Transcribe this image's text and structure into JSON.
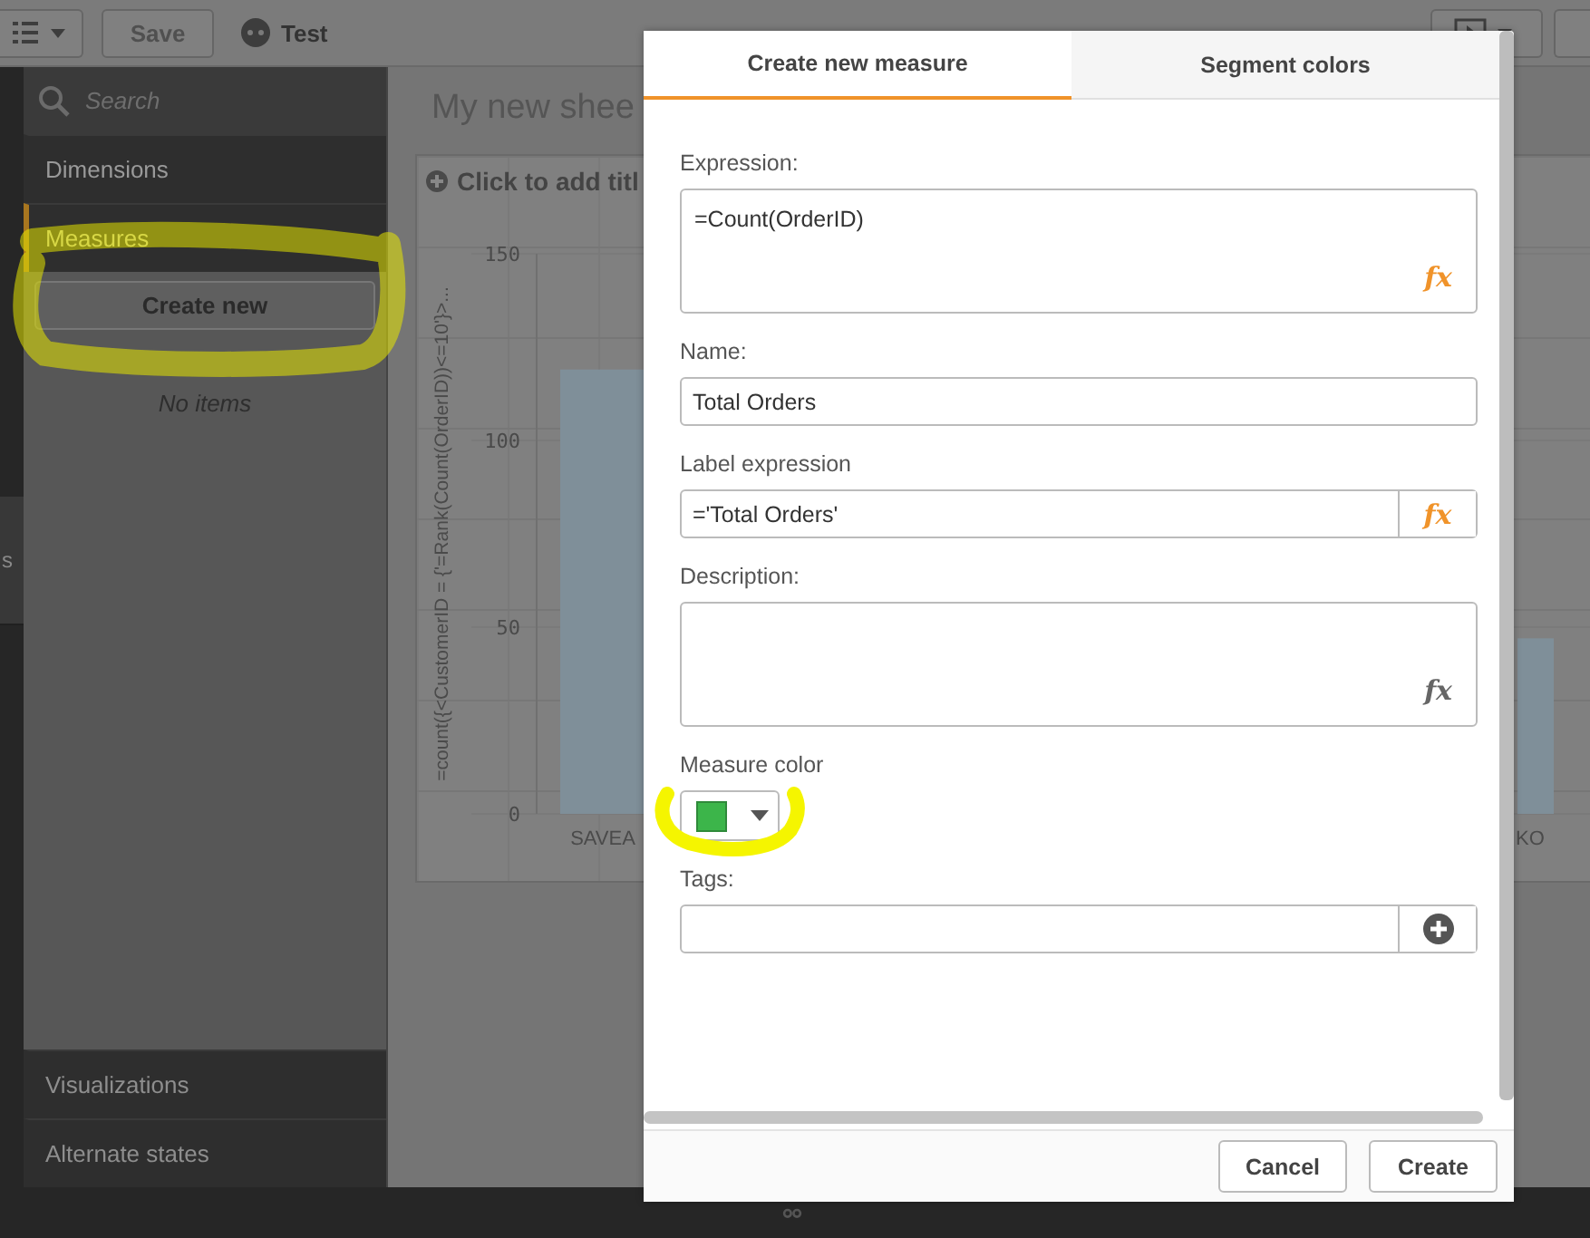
{
  "toolbar": {
    "save_button": "Save",
    "app_title": "Test"
  },
  "left_strip": {
    "items": [
      "s"
    ]
  },
  "assets_panel": {
    "search": {
      "placeholder": "Search"
    },
    "sections": [
      {
        "label": "Dimensions",
        "selected": false
      },
      {
        "label": "Measures",
        "selected": true
      }
    ],
    "create_button": "Create new",
    "empty_text": "No items",
    "bottom_sections": [
      {
        "label": "Visualizations"
      },
      {
        "label": "Alternate states"
      }
    ]
  },
  "sheet": {
    "title": "My new shee",
    "chart": {
      "add_title": "Click to add titl",
      "chart_data": {
        "type": "bar",
        "ylabel": "=count({<CustomerID = {'=Rank(Count(OrderID))<=10'}>...",
        "categories": [
          "SAVEA",
          "KO"
        ],
        "values": [
          119,
          47
        ],
        "ylim": [
          0,
          150
        ],
        "yticks": [
          0,
          50,
          100,
          150
        ]
      }
    }
  },
  "dialog": {
    "tabs": [
      {
        "label": "Create new measure",
        "selected": true
      },
      {
        "label": "Segment colors",
        "selected": false
      }
    ],
    "fields": [
      {
        "kind": "expression",
        "label": "Expression:",
        "value": "=Count(OrderID)",
        "fx": "fx",
        "fx_active": true
      },
      {
        "kind": "text",
        "label": "Name:",
        "value": "Total Orders"
      },
      {
        "kind": "text-fx",
        "label": "Label expression",
        "value": "='Total Orders'",
        "fx": "fx",
        "fx_active": true
      },
      {
        "kind": "expression",
        "label": "Description:",
        "fx": "fx",
        "fx_active": false
      },
      {
        "kind": "color",
        "label": "Measure color",
        "color": "#3cb54a"
      },
      {
        "kind": "tags",
        "label": "Tags:"
      }
    ],
    "buttons": [
      {
        "label": "Cancel"
      },
      {
        "label": "Create"
      }
    ]
  }
}
